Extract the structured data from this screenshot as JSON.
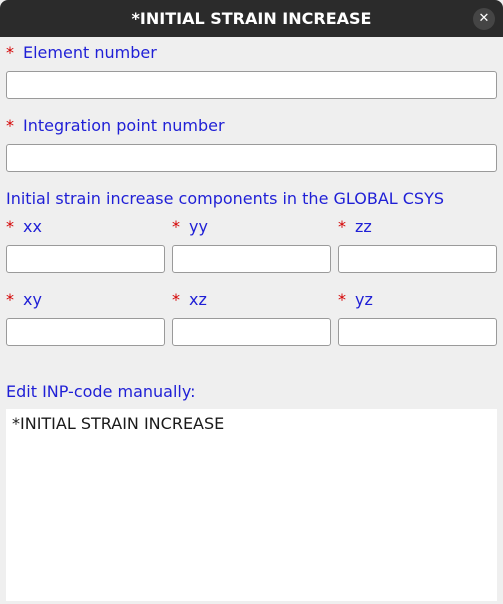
{
  "window": {
    "title": "*INITIAL STRAIN INCREASE",
    "close_glyph": "✕"
  },
  "required_marker": "*",
  "fields": {
    "element_number": {
      "label": "Element number",
      "value": ""
    },
    "integration_point": {
      "label": "Integration point number",
      "value": ""
    }
  },
  "components_header": "Initial strain increase components in the GLOBAL CSYS",
  "components": {
    "xx": {
      "label": "xx",
      "value": ""
    },
    "yy": {
      "label": "yy",
      "value": ""
    },
    "zz": {
      "label": "zz",
      "value": ""
    },
    "xy": {
      "label": "xy",
      "value": ""
    },
    "xz": {
      "label": "xz",
      "value": ""
    },
    "yz": {
      "label": "yz",
      "value": ""
    }
  },
  "inp_editor": {
    "label": "Edit INP-code manually:",
    "code": "*INITIAL STRAIN INCREASE"
  },
  "colors": {
    "label_blue": "#1f1fd6",
    "required_red": "#d40000",
    "titlebar": "#2b2b2b"
  }
}
